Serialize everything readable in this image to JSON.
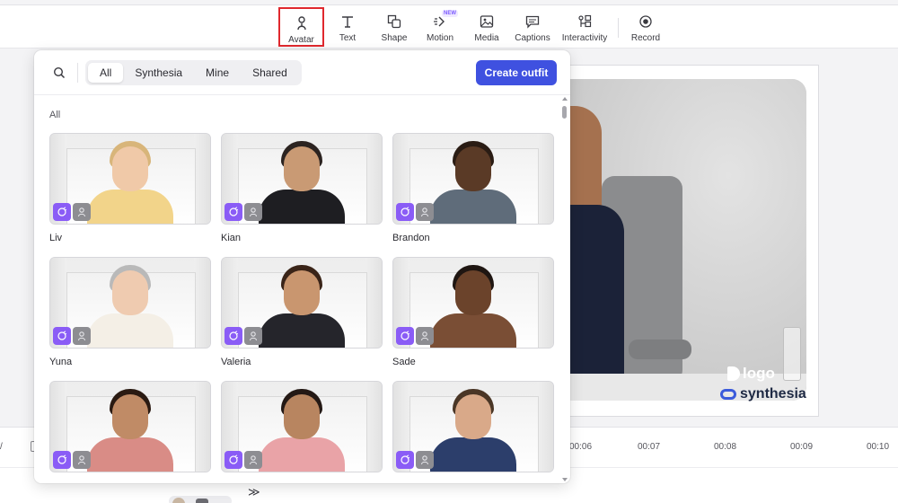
{
  "toolbar": {
    "items": [
      {
        "label": "Avatar",
        "icon": "avatar-icon",
        "active": true
      },
      {
        "label": "Text",
        "icon": "text-icon"
      },
      {
        "label": "Shape",
        "icon": "shape-icon"
      },
      {
        "label": "Motion",
        "icon": "motion-icon",
        "badge": "NEW"
      },
      {
        "label": "Media",
        "icon": "media-icon"
      },
      {
        "label": "Captions",
        "icon": "captions-icon"
      },
      {
        "label": "Interactivity",
        "icon": "interactivity-icon"
      },
      {
        "label": "Record",
        "icon": "record-icon"
      }
    ]
  },
  "panel": {
    "filters": [
      "All",
      "Synthesia",
      "Mine",
      "Shared"
    ],
    "selected_filter": "All",
    "create_button": "Create outfit",
    "section_label": "All",
    "avatars": [
      {
        "name": "Liv",
        "skin": "#f0c9a8",
        "hair": "#d8b57a",
        "shirt": "#f2d48a"
      },
      {
        "name": "Kian",
        "skin": "#c99a74",
        "hair": "#2b2320",
        "shirt": "#1e1e22"
      },
      {
        "name": "Brandon",
        "skin": "#5a3a26",
        "hair": "#2a1c14",
        "shirt": "#5f6c7a"
      },
      {
        "name": "Yuna",
        "skin": "#efcbb0",
        "hair": "#b9b9b9",
        "shirt": "#f4efe6"
      },
      {
        "name": "Valeria",
        "skin": "#c9966f",
        "hair": "#3a2418",
        "shirt": "#25252b"
      },
      {
        "name": "Sade",
        "skin": "#6b432b",
        "hair": "#1f1612",
        "shirt": "#7a4e35"
      },
      {
        "name": "",
        "skin": "#c08b66",
        "hair": "#2a1a12",
        "shirt": "#d98c86"
      },
      {
        "name": "",
        "skin": "#b88560",
        "hair": "#241915",
        "shirt": "#e9a3a7"
      },
      {
        "name": "",
        "skin": "#d9a989",
        "hair": "#4a3626",
        "shirt": "#2c3e6b"
      }
    ]
  },
  "timeline": {
    "ticks": [
      "00:06",
      "00:07",
      "00:08",
      "00:09",
      "00:10"
    ],
    "left_marker": "/"
  },
  "preview": {
    "watermark_logo": "logo",
    "watermark_brand": "synthesia"
  },
  "colors": {
    "accent": "#3f51e0",
    "active_outline": "#e0282e",
    "badge_purple": "#8a5cf6"
  }
}
